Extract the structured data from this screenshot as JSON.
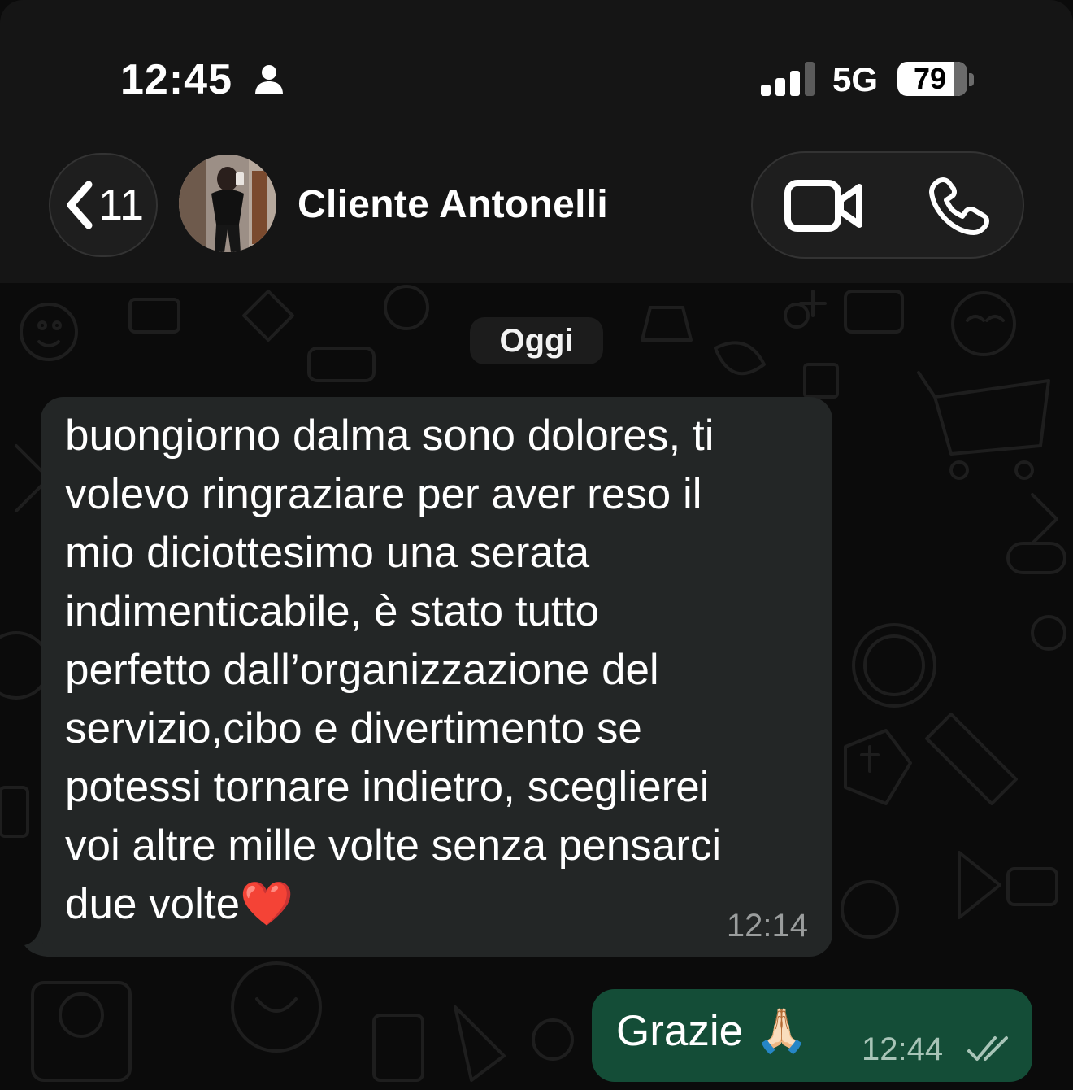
{
  "status_bar": {
    "time": "12:45",
    "person_icon": "person-icon",
    "signal_icon": "signal-bars-icon",
    "network": "5G",
    "battery": "79",
    "battery_level": 0.79
  },
  "header": {
    "back_icon": "chevron-left-icon",
    "back_count": "11",
    "contact_name": "Cliente Antonelli",
    "video_icon": "video-camera-icon",
    "phone_icon": "phone-icon"
  },
  "chat": {
    "date_divider": "Oggi",
    "messages": [
      {
        "direction": "incoming",
        "text": "buongiorno dalma sono dolores, ti\nvolevo ringraziare per aver reso il\nmio diciottesimo una serata\nindimenticabile, è stato tutto\nperfetto dall’organizzazione del\nservizio,cibo e divertimento se\npotessi tornare indietro, sceglierei\nvoi altre mille volte senza pensarci\ndue volte❤️",
        "time": "12:14"
      },
      {
        "direction": "outgoing",
        "text": "Grazie 🙏🏻",
        "time": "12:44",
        "status_icon": "double-check-icon"
      }
    ]
  },
  "colors": {
    "background": "#0b0b0b",
    "header_bg": "#151515",
    "incoming_bubble": "#232626",
    "outgoing_bubble": "#144d37",
    "timestamp_gray": "#9a9d9d"
  }
}
